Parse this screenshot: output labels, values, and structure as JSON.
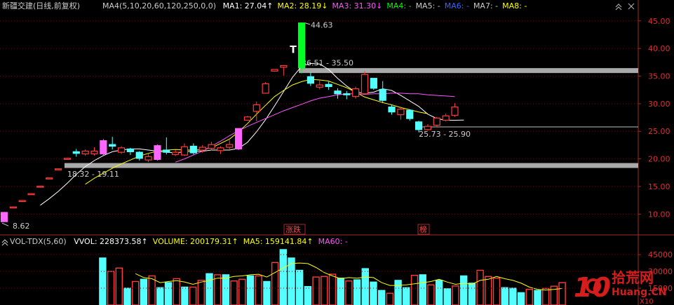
{
  "chart_data": [
    {
      "type": "candlestick",
      "stock_name": "新疆交建",
      "period_label": "(日线,前复权)",
      "ma_header": {
        "params": "MA4(5,10,20,60,120,250,0,0)",
        "items": [
          {
            "text": "MA1: 27.04↑",
            "color": "#ffffff"
          },
          {
            "text": "MA2: 28.19↓",
            "color": "#ffff00"
          },
          {
            "text": "MA3: 31.30↓",
            "color": "#ff55ff"
          },
          {
            "text": "MA4: -",
            "color": "#00ff00"
          },
          {
            "text": "MA5: -",
            "color": "#cccccc"
          },
          {
            "text": "MA6: -",
            "color": "#3366ff"
          },
          {
            "text": "MA7: -",
            "color": "#cccccc"
          },
          {
            "text": "MA8: -",
            "color": "#ffff00"
          }
        ]
      },
      "y_axis": {
        "min": 7.5,
        "max": 46.5,
        "ticks": [
          "10.00",
          "15.00",
          "20.00",
          "25.00",
          "30.00",
          "35.00",
          "40.00",
          "45.00"
        ]
      },
      "candles": [
        {
          "o": 8.62,
          "c": 10.3,
          "h": 10.3,
          "l": 8.62,
          "k": "limit"
        },
        {
          "o": 11.3,
          "c": 11.3,
          "h": 11.3,
          "l": 11.3,
          "k": "limit"
        },
        {
          "o": 12.45,
          "c": 12.45,
          "h": 12.45,
          "l": 12.45,
          "k": "limit"
        },
        {
          "o": 13.7,
          "c": 13.7,
          "h": 13.7,
          "l": 13.7,
          "k": "limit"
        },
        {
          "o": 15.05,
          "c": 15.05,
          "h": 15.05,
          "l": 15.05,
          "k": "limit"
        },
        {
          "o": 16.55,
          "c": 16.55,
          "h": 16.55,
          "l": 16.55,
          "k": "limit"
        },
        {
          "o": 18.2,
          "c": 18.2,
          "h": 18.2,
          "l": 18.2,
          "k": "limit"
        },
        {
          "o": 20.1,
          "c": 20.1,
          "h": 20.1,
          "l": 20.1,
          "k": "limit"
        },
        {
          "o": 21.3,
          "c": 21.0,
          "h": 21.8,
          "l": 20.4,
          "k": "cross"
        },
        {
          "o": 20.9,
          "c": 21.4,
          "h": 21.7,
          "l": 20.6,
          "k": "up"
        },
        {
          "o": 20.9,
          "c": 21.4,
          "h": 22.1,
          "l": 20.6,
          "k": "up"
        },
        {
          "o": 20.9,
          "c": 23.3,
          "h": 23.6,
          "l": 20.6,
          "k": "limit"
        },
        {
          "o": 22.6,
          "c": 22.3,
          "h": 24.0,
          "l": 21.7,
          "k": "down"
        },
        {
          "o": 21.2,
          "c": 22.0,
          "h": 22.3,
          "l": 20.9,
          "k": "up"
        },
        {
          "o": 21.8,
          "c": 21.3,
          "h": 22.0,
          "l": 20.7,
          "k": "down"
        },
        {
          "o": 21.2,
          "c": 20.1,
          "h": 21.4,
          "l": 19.7,
          "k": "down"
        },
        {
          "o": 19.8,
          "c": 20.4,
          "h": 21.0,
          "l": 19.4,
          "k": "up"
        },
        {
          "o": 19.9,
          "c": 22.4,
          "h": 22.6,
          "l": 19.7,
          "k": "limit"
        },
        {
          "o": 21.6,
          "c": 21.2,
          "h": 23.9,
          "l": 20.8,
          "k": "down"
        },
        {
          "o": 20.8,
          "c": 21.2,
          "h": 21.6,
          "l": 20.5,
          "k": "up"
        },
        {
          "o": 20.7,
          "c": 22.2,
          "h": 22.8,
          "l": 20.5,
          "k": "up"
        },
        {
          "o": 22.3,
          "c": 21.1,
          "h": 22.8,
          "l": 20.8,
          "k": "down"
        },
        {
          "o": 21.6,
          "c": 22.1,
          "h": 22.5,
          "l": 21.1,
          "k": "up"
        },
        {
          "o": 21.9,
          "c": 22.6,
          "h": 23.1,
          "l": 21.5,
          "k": "up"
        },
        {
          "o": 21.5,
          "c": 22.0,
          "h": 22.3,
          "l": 20.9,
          "k": "up"
        },
        {
          "o": 22.1,
          "c": 22.6,
          "h": 23.4,
          "l": 21.6,
          "k": "up"
        },
        {
          "o": 21.8,
          "c": 25.5,
          "h": 25.5,
          "l": 21.6,
          "k": "limit"
        },
        {
          "o": 27.0,
          "c": 27.6,
          "h": 27.8,
          "l": 27.0,
          "k": "up"
        },
        {
          "o": 28.6,
          "c": 29.8,
          "h": 30.4,
          "l": 26.8,
          "k": "up"
        },
        {
          "o": 31.9,
          "c": 33.6,
          "h": 33.9,
          "l": 31.9,
          "k": "up"
        },
        {
          "o": 35.9,
          "c": 36.2,
          "h": 36.2,
          "l": 35.8,
          "k": "limit"
        },
        {
          "o": 36.6,
          "c": 36.9,
          "h": 37.0,
          "l": 35.1,
          "k": "up"
        },
        {
          "o": 39.8,
          "c": 39.8,
          "h": 39.9,
          "l": 39.8,
          "k": "t"
        },
        {
          "o": 44.63,
          "c": 36.51,
          "h": 44.63,
          "l": 35.5,
          "k": "green"
        },
        {
          "o": 34.9,
          "c": 33.7,
          "h": 35.7,
          "l": 33.2,
          "k": "down"
        },
        {
          "o": 33.4,
          "c": 33.0,
          "h": 34.3,
          "l": 32.6,
          "k": "up"
        },
        {
          "o": 33.5,
          "c": 33.1,
          "h": 34.0,
          "l": 32.5,
          "k": "cross"
        },
        {
          "o": 32.3,
          "c": 31.8,
          "h": 32.8,
          "l": 30.9,
          "k": "cross"
        },
        {
          "o": 31.8,
          "c": 31.7,
          "h": 32.3,
          "l": 30.8,
          "k": "cross"
        },
        {
          "o": 31.3,
          "c": 32.7,
          "h": 33.1,
          "l": 30.9,
          "k": "up"
        },
        {
          "o": 31.8,
          "c": 35.3,
          "h": 35.9,
          "l": 31.8,
          "k": "up"
        },
        {
          "o": 34.6,
          "c": 32.8,
          "h": 34.6,
          "l": 32.5,
          "k": "down"
        },
        {
          "o": 32.6,
          "c": 30.6,
          "h": 34.1,
          "l": 30.1,
          "k": "down"
        },
        {
          "o": 29.4,
          "c": 28.5,
          "h": 29.8,
          "l": 28.0,
          "k": "down"
        },
        {
          "o": 28.0,
          "c": 29.0,
          "h": 29.5,
          "l": 27.1,
          "k": "up"
        },
        {
          "o": 28.8,
          "c": 27.3,
          "h": 29.0,
          "l": 26.9,
          "k": "down"
        },
        {
          "o": 26.7,
          "c": 25.3,
          "h": 26.9,
          "l": 24.8,
          "k": "down"
        },
        {
          "o": 25.3,
          "c": 25.9,
          "h": 26.3,
          "l": 25.1,
          "k": "up"
        },
        {
          "o": 26.1,
          "c": 27.4,
          "h": 27.6,
          "l": 25.9,
          "k": "up"
        },
        {
          "o": 27.0,
          "c": 27.8,
          "h": 28.2,
          "l": 26.8,
          "k": "up"
        },
        {
          "o": 27.9,
          "c": 29.4,
          "h": 30.1,
          "l": 27.6,
          "k": "up"
        }
      ],
      "ma_lines": [
        {
          "name": "MA1",
          "color": "#ffffff",
          "start": 4,
          "values": [
            11.6,
            12.8,
            14.1,
            15.6,
            17.2,
            18.6,
            19.7,
            20.6,
            21.3,
            21.6,
            21.8,
            21.8,
            21.6,
            21.4,
            21.2,
            21.1,
            21.3,
            21.4,
            21.4,
            21.6,
            21.6,
            21.6,
            21.9,
            23.0,
            24.9,
            27.1,
            29.6,
            32.2,
            34.8,
            36.8,
            37.3,
            37.2,
            36.2,
            34.6,
            33.2,
            32.1,
            31.9,
            32.1,
            32.7,
            32.4,
            31.5,
            30.5,
            29.5,
            28.1,
            27.3,
            27.0,
            27.0,
            27.04
          ]
        },
        {
          "name": "MA2",
          "color": "#ffff00",
          "start": 9,
          "values": [
            15.4,
            16.5,
            17.4,
            18.3,
            19.1,
            19.8,
            20.5,
            21.0,
            21.4,
            21.6,
            21.7,
            21.6,
            21.6,
            21.7,
            22.0,
            22.8,
            23.6,
            24.9,
            26.4,
            28.1,
            29.7,
            31.3,
            32.4,
            33.4,
            34.0,
            34.4,
            34.3,
            34.1,
            33.5,
            32.9,
            32.1,
            31.2,
            30.7,
            30.2,
            29.8,
            29.3,
            28.9,
            28.5,
            28.19
          ]
        },
        {
          "name": "MA3",
          "color": "#ff55ff",
          "start": 19,
          "values": [
            19.4,
            20.0,
            20.7,
            21.4,
            22.3,
            23.2,
            24.2,
            25.1,
            25.9,
            26.6,
            27.3,
            28.0,
            28.7,
            29.3,
            29.9,
            30.5,
            31.0,
            31.3,
            31.6,
            31.8,
            31.8,
            31.7,
            31.8,
            31.8,
            31.9,
            31.9,
            31.8,
            31.8,
            31.6,
            31.5,
            31.4,
            31.3
          ]
        }
      ],
      "hlines": [
        {
          "y": 36.0,
          "from": 33,
          "to": 999,
          "style": "band",
          "label": "36.51 - 35.50"
        },
        {
          "y": 25.8,
          "from": 46,
          "to": 999,
          "style": "line",
          "label": "25.73 - 25.90"
        },
        {
          "y": 18.8,
          "from": 7,
          "to": 999,
          "style": "band",
          "label": "18.32 - 19.11"
        }
      ],
      "annotations": {
        "high": "44.63",
        "low": "8.62",
        "t_mark": "T",
        "tag_zhangdie": "涨跌",
        "tag_bang": "榜"
      }
    },
    {
      "type": "bar",
      "indicator": "VOL-TDX(5,60)",
      "items": [
        {
          "text": "VVOL: 228373.58↑",
          "color": "#ffffff"
        },
        {
          "text": "VOLUME: 200179.31↑",
          "color": "#ffff00"
        },
        {
          "text": "MA5: 159141.84↑",
          "color": "#ffff00"
        },
        {
          "text": "MA60: -",
          "color": "#ff55ff"
        }
      ],
      "y_axis": {
        "max": 52000,
        "ticks": [
          "15000",
          "30000",
          "45000"
        ],
        "unit_label": "X10"
      },
      "volume": [
        0,
        0,
        0,
        0,
        0,
        0,
        0,
        0,
        0,
        0,
        0,
        0,
        42000,
        30000,
        33000,
        15000,
        21000,
        23000,
        26000,
        15500,
        20000,
        23500,
        16000,
        16000,
        22000,
        28000,
        27000,
        27000,
        21500,
        23000,
        26000,
        26000,
        21000,
        38000,
        49500,
        42000,
        31000,
        16500,
        25000,
        25500,
        27500,
        24000,
        21500,
        22500,
        32500,
        20500,
        13000,
        10500,
        22000,
        15500,
        26500,
        27000,
        18000,
        22000,
        14500,
        17000,
        26000,
        19500,
        31000,
        25500,
        24000,
        15500,
        15000,
        11000,
        14000,
        13000,
        14800,
        16800,
        20000
      ],
      "vol_colors": [
        "#0000",
        "#0000",
        "#0000",
        "#0000",
        "#0000",
        "#0000",
        "#0000",
        "#0000",
        "#0000",
        "#0000",
        "#0000",
        "#0000",
        "cyan",
        "red",
        "red",
        "cyan",
        "red",
        "cyan",
        "red",
        "cyan",
        "cyan",
        "red",
        "cyan",
        "red",
        "red",
        "cyan",
        "red",
        "cyan",
        "red",
        "red",
        "cyan",
        "red",
        "cyan",
        "red",
        "cyan",
        "cyan",
        "cyan",
        "cyan",
        "red",
        "red",
        "red",
        "cyan",
        "red",
        "cyan",
        "cyan",
        "cyan",
        "cyan",
        "red",
        "cyan",
        "cyan",
        "red",
        "cyan",
        "red",
        "cyan",
        "cyan",
        "red",
        "cyan",
        "cyan",
        "red",
        "red",
        "red",
        "cyan",
        "cyan",
        "cyan",
        "red",
        "cyan",
        "red",
        "red",
        "red"
      ],
      "vol_ma5": [
        0,
        0,
        0,
        0,
        0,
        0,
        0,
        0,
        0,
        0,
        0,
        0,
        0,
        0,
        0,
        0,
        28000,
        24500,
        23500,
        20000,
        21000,
        21800,
        20500,
        18500,
        20500,
        22000,
        24000,
        24000,
        25500,
        26000,
        27000,
        27500,
        25000,
        29000,
        33000,
        37000,
        37500,
        37000,
        33500,
        29000,
        26000,
        23500,
        24500,
        24000,
        25000,
        24500,
        20000,
        17500,
        17500,
        18000,
        19000,
        20000,
        21000,
        23000,
        20500,
        18500,
        19500,
        18500,
        22000,
        23000,
        25500,
        23500,
        22000,
        19500,
        16000,
        14000,
        13300,
        14000,
        14800
      ]
    }
  ],
  "watermark": {
    "num": "10",
    "cn": "拾荒网",
    "url": "Huang.CN"
  }
}
